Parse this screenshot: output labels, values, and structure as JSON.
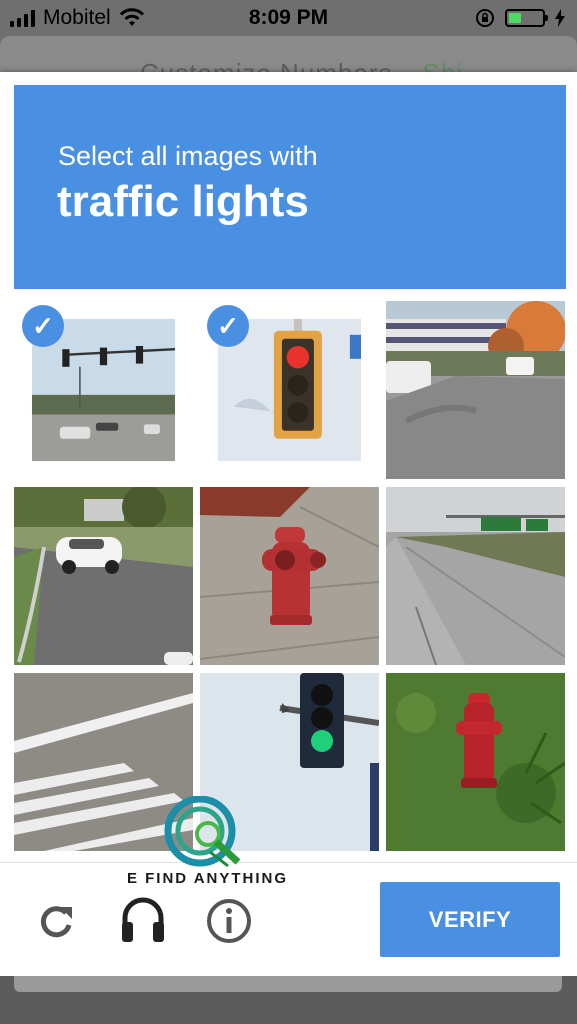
{
  "status_bar": {
    "carrier": "Mobitel",
    "time": "8:09 PM",
    "battery_level": 0.3
  },
  "background_page": {
    "text_left": "Customize Numbers",
    "text_right": "Shi"
  },
  "captcha": {
    "prompt_line1": "Select all images with",
    "prompt_line2": "traffic lights",
    "header_color": "#4a90e2",
    "tiles": [
      {
        "content": "intersection with traffic lights",
        "selected": true
      },
      {
        "content": "close-up red traffic light",
        "selected": true
      },
      {
        "content": "parking lot road",
        "selected": false
      },
      {
        "content": "white car on road",
        "selected": false
      },
      {
        "content": "red fire hydrant on sidewalk",
        "selected": false
      },
      {
        "content": "highway with road signs",
        "selected": false
      },
      {
        "content": "crosswalk markings",
        "selected": false
      },
      {
        "content": "green traffic light",
        "selected": false
      },
      {
        "content": "red fire hydrant on grass",
        "selected": false
      }
    ],
    "check_mark": "✓",
    "reload_icon": "reload-icon",
    "audio_icon": "headphones-icon",
    "info_icon": "info-icon",
    "verify_label": "VERIFY"
  },
  "watermark": {
    "text": "E FIND ANYTHING"
  }
}
